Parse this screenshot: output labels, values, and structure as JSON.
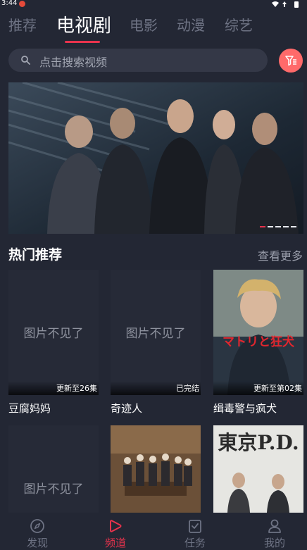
{
  "status_bar": {
    "time": "3:44"
  },
  "tabs": [
    {
      "label": "推荐"
    },
    {
      "label": "电视剧"
    },
    {
      "label": "电影"
    },
    {
      "label": "动漫"
    },
    {
      "label": "综艺"
    }
  ],
  "active_tab": "电视剧",
  "search": {
    "placeholder": "点击搜索视频",
    "icon": "search-icon"
  },
  "filter_button": {
    "icon": "filter-icon",
    "color": "#ff6a6a"
  },
  "banner": {
    "slide_count": 5,
    "active_slide": 1
  },
  "section": {
    "title": "热门推荐",
    "more_label": "查看更多"
  },
  "cards": [
    {
      "title": "豆腐妈妈",
      "badge": "更新至26集",
      "placeholder": "图片不见了"
    },
    {
      "title": "奇迹人",
      "badge": "已完结",
      "placeholder": "图片不见了"
    },
    {
      "title": "缉毒警与疯犬",
      "badge": "更新至第02集",
      "poster_text": "マトリと狂犬"
    },
    {
      "title": "",
      "badge": "",
      "placeholder": "图片不见了"
    },
    {
      "title": "",
      "badge": ""
    },
    {
      "title": "",
      "badge": "",
      "poster_text": "東京P.D."
    }
  ],
  "bottom_nav": [
    {
      "label": "发现",
      "icon": "compass-icon"
    },
    {
      "label": "频道",
      "icon": "play-icon"
    },
    {
      "label": "任务",
      "icon": "task-icon"
    },
    {
      "label": "我的",
      "icon": "user-icon"
    }
  ],
  "colors": {
    "accent": "#e8334d",
    "background": "#232734"
  }
}
